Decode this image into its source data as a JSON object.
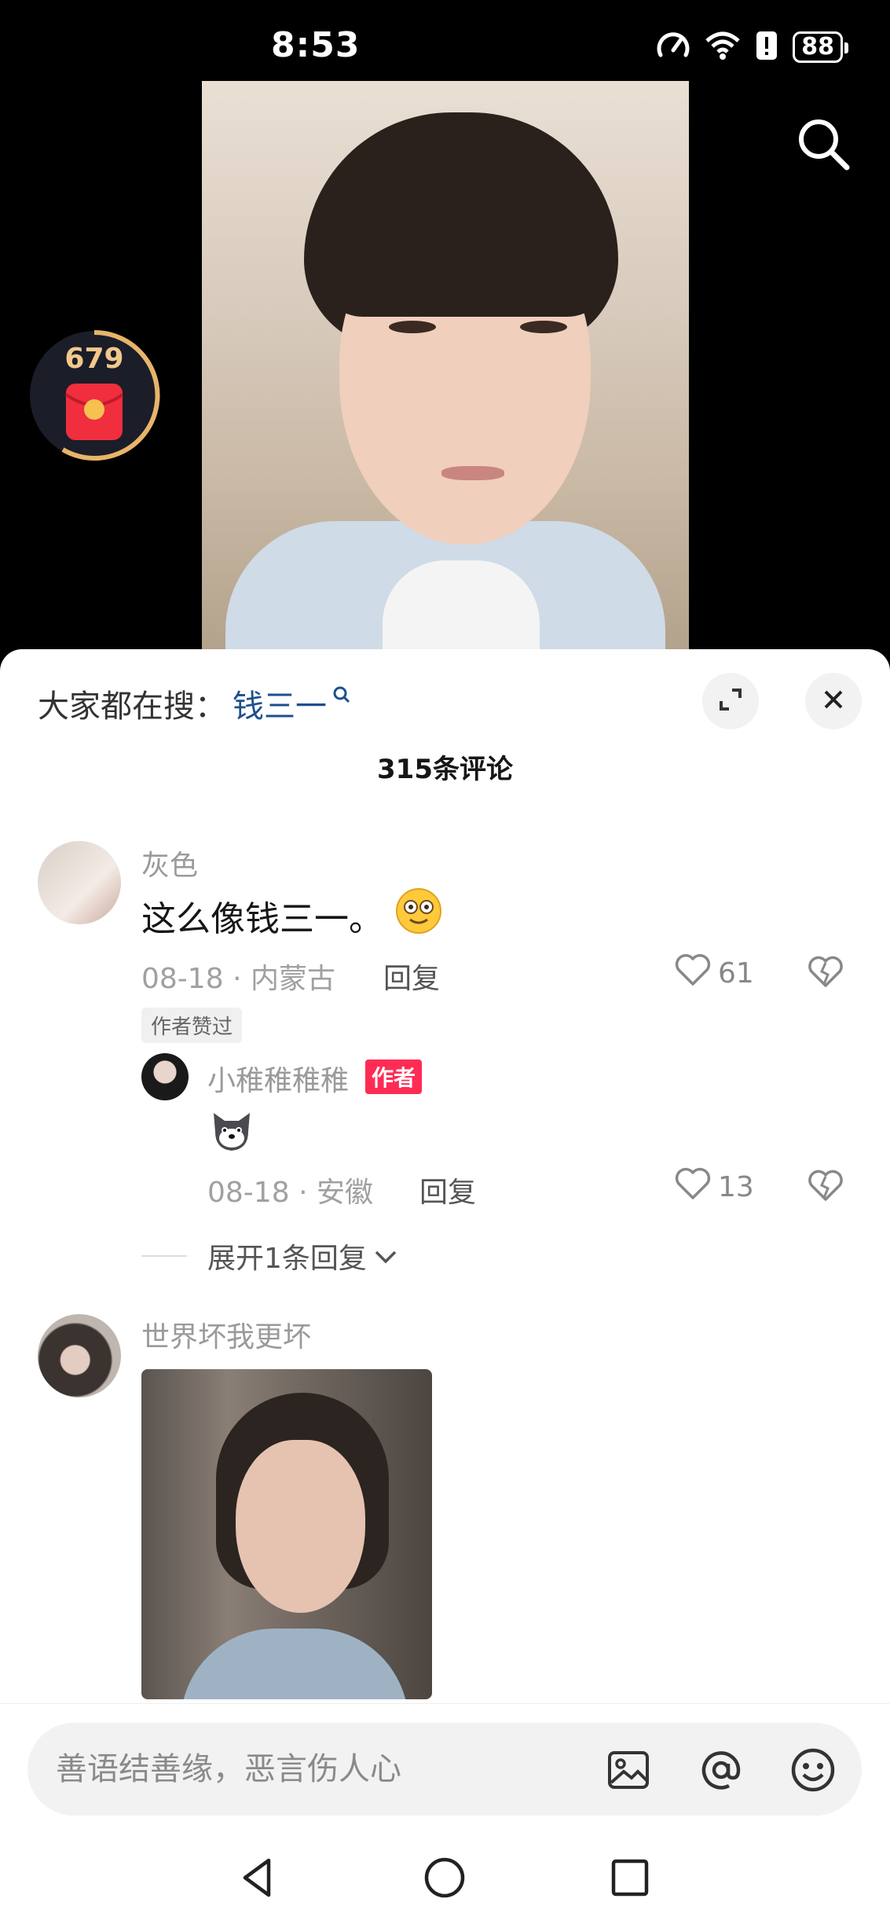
{
  "status_bar": {
    "time": "8:53",
    "battery": "88"
  },
  "red_packet": {
    "count": "679"
  },
  "sheet": {
    "search_hint_label": "大家都在搜：",
    "search_hint_term": "钱三一",
    "comment_count": "315条评论"
  },
  "comments": [
    {
      "username": "灰色",
      "text": "这么像钱三一。",
      "date": "08-18",
      "location": "内蒙古",
      "reply_label": "回复",
      "likes": "61",
      "author_liked_tag": "作者赞过",
      "replies": [
        {
          "username": "小稚稚稚稚",
          "badge": "作者",
          "date": "08-18",
          "location": "安徽",
          "reply_label": "回复",
          "likes": "13"
        }
      ],
      "expand_label": "展开1条回复"
    },
    {
      "username": "世界坏我更坏"
    }
  ],
  "input": {
    "placeholder": "善语结善缘，恶言伤人心"
  },
  "colors": {
    "accent": "#fe2c55",
    "link": "#1e4f8e",
    "muted": "#9a9a9a"
  }
}
